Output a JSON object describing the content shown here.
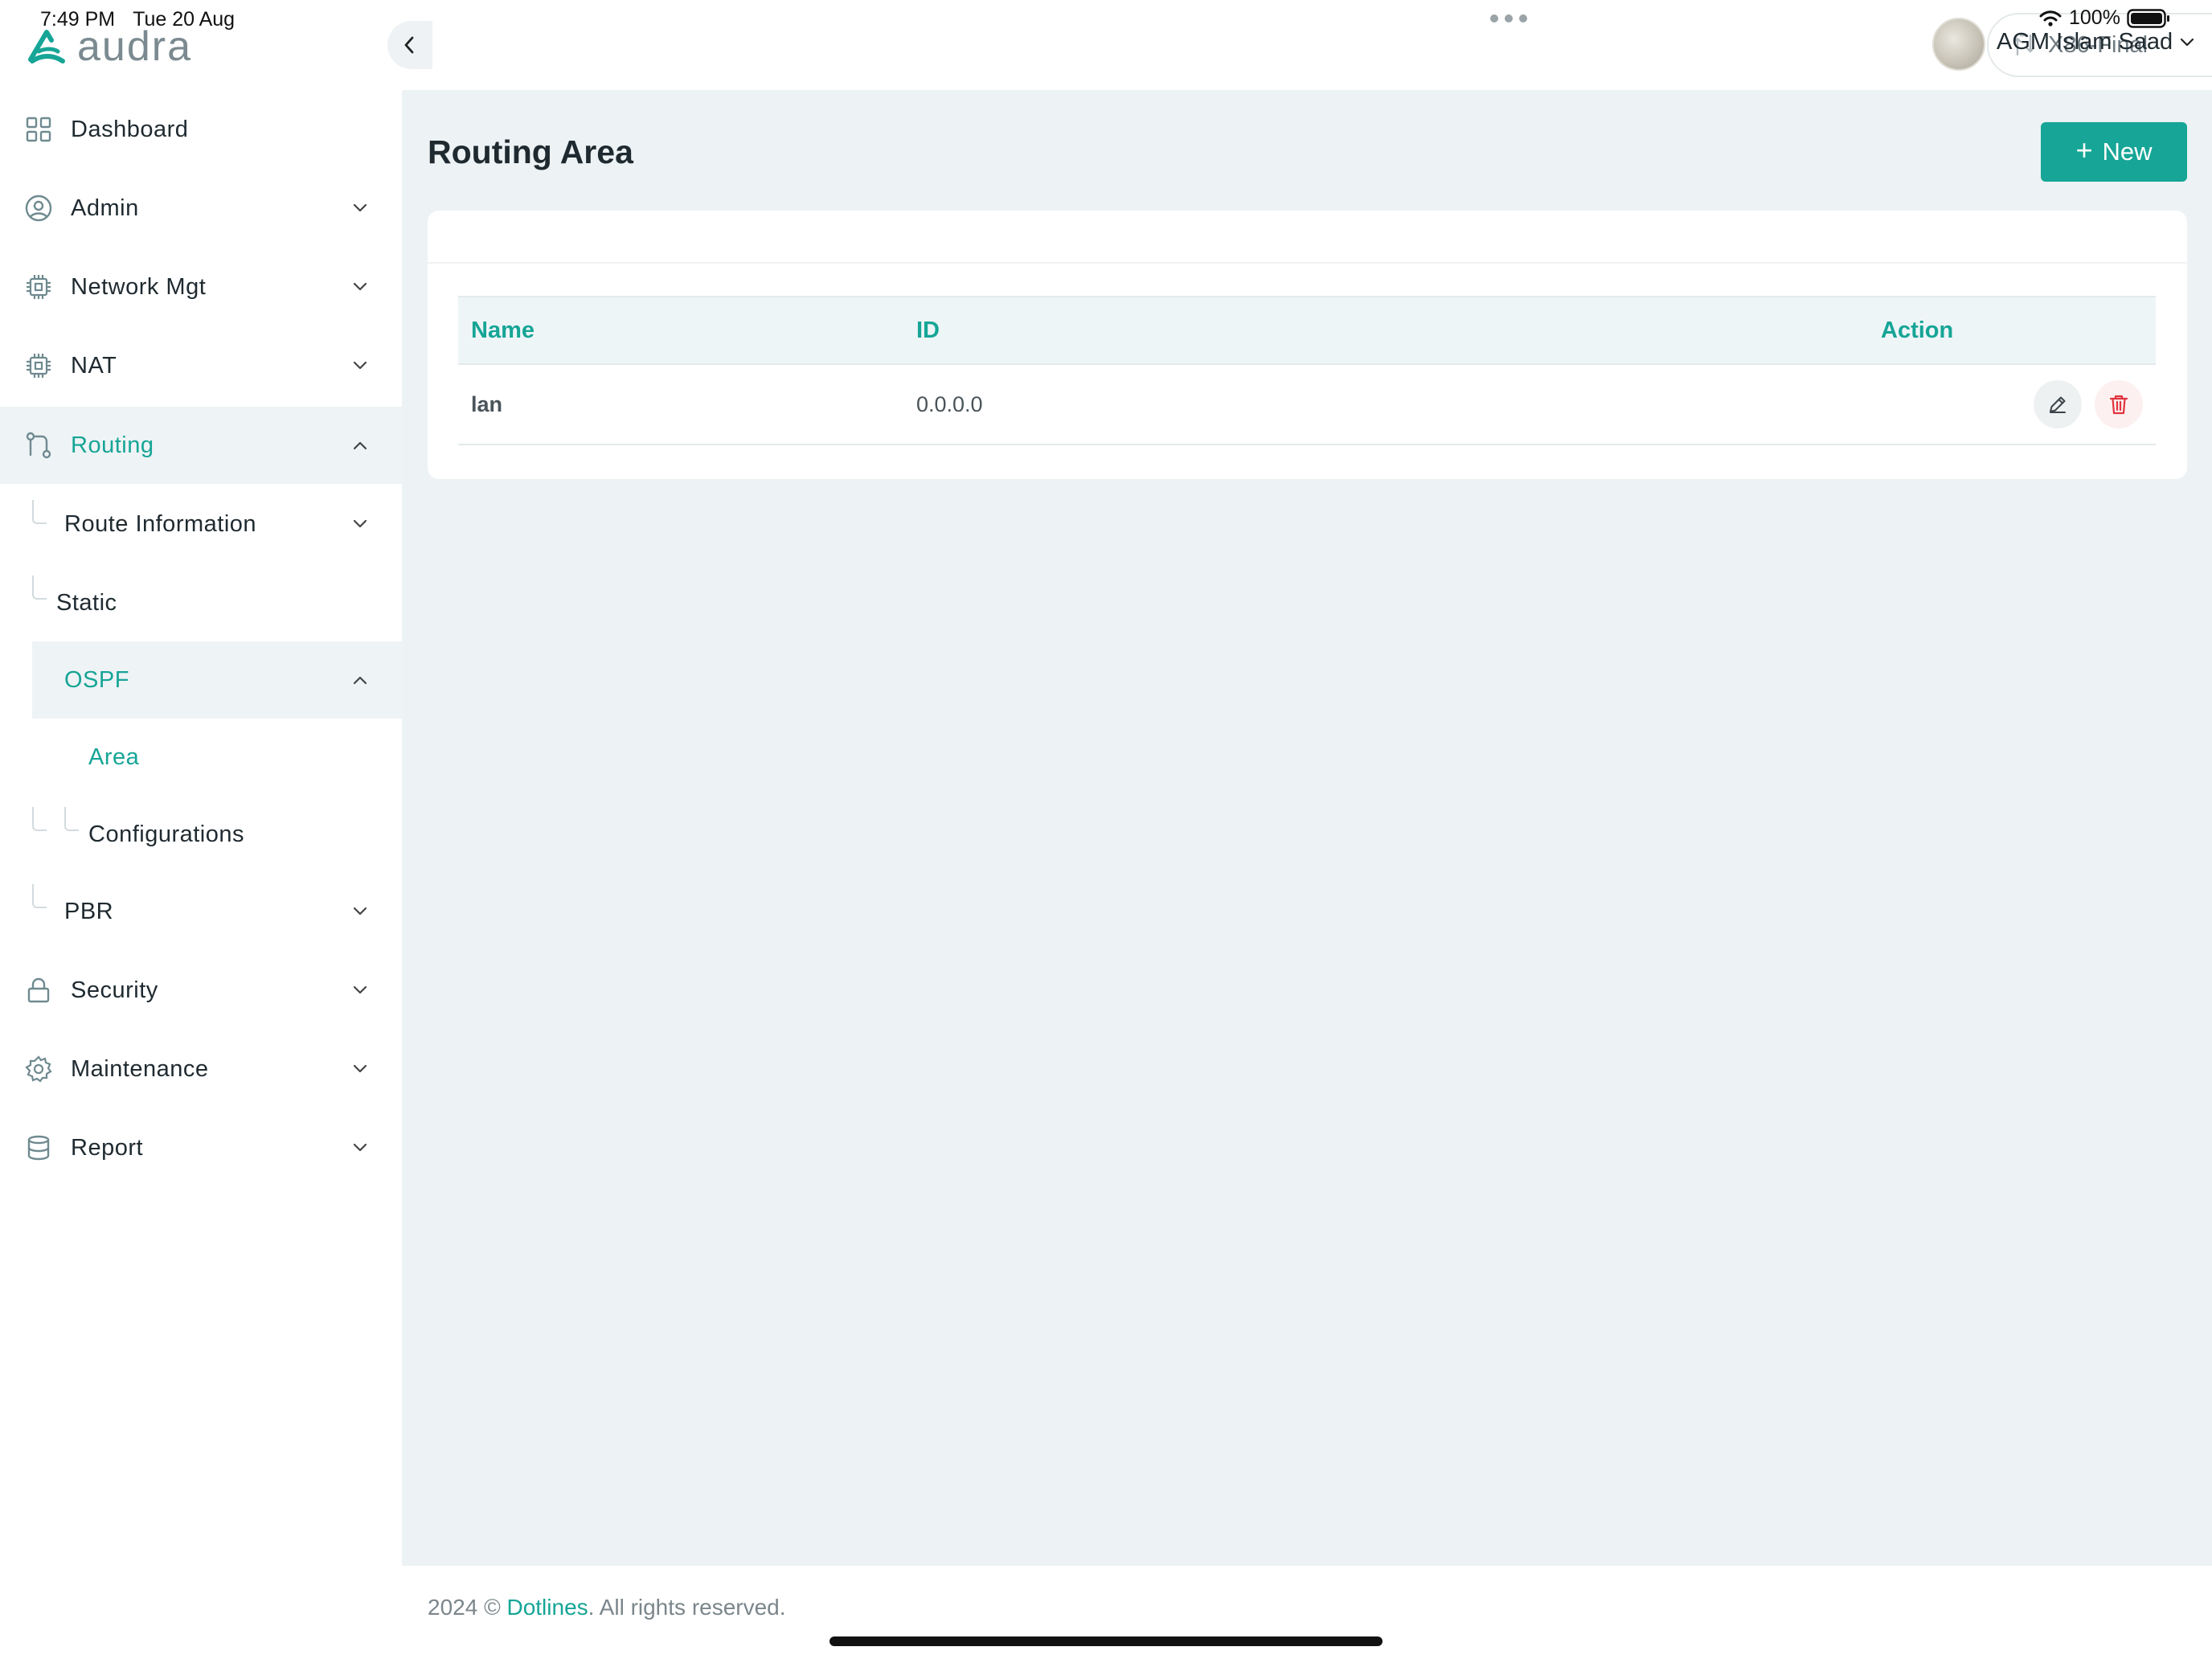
{
  "status_bar": {
    "time": "7:49 PM",
    "date": "Tue 20 Aug",
    "battery": "100%"
  },
  "brand": {
    "name": "audra",
    "color": "#16a596"
  },
  "sidebar": {
    "items": [
      {
        "label": "Dashboard",
        "icon": "grid-icon"
      },
      {
        "label": "Admin",
        "icon": "user-circle-icon"
      },
      {
        "label": "Network Mgt",
        "icon": "chip-icon"
      },
      {
        "label": "NAT",
        "icon": "chip-icon"
      },
      {
        "label": "Routing",
        "icon": "route-icon",
        "active": true
      },
      {
        "label": "Security",
        "icon": "lock-icon"
      },
      {
        "label": "Maintenance",
        "icon": "gear-icon"
      },
      {
        "label": "Report",
        "icon": "database-icon"
      }
    ],
    "routing_sub": {
      "route_information": "Route Information",
      "static": "Static",
      "ospf": "OSPF",
      "area": "Area",
      "configurations": "Configurations",
      "pbr": "PBR"
    }
  },
  "header": {
    "device": "X86-Final",
    "user": "AGM Islam Saad"
  },
  "main": {
    "title": "Routing Area",
    "new_label": "New",
    "table": {
      "columns": [
        "Name",
        "ID",
        "Action"
      ],
      "rows": [
        {
          "name": "lan",
          "id": "0.0.0.0"
        }
      ]
    }
  },
  "footer": {
    "prefix": "2024 © ",
    "brand": "Dotlines",
    "suffix": ". All rights reserved."
  },
  "colors": {
    "accent": "#16a596",
    "danger": "#e0343f",
    "background": "#edf2f4"
  }
}
